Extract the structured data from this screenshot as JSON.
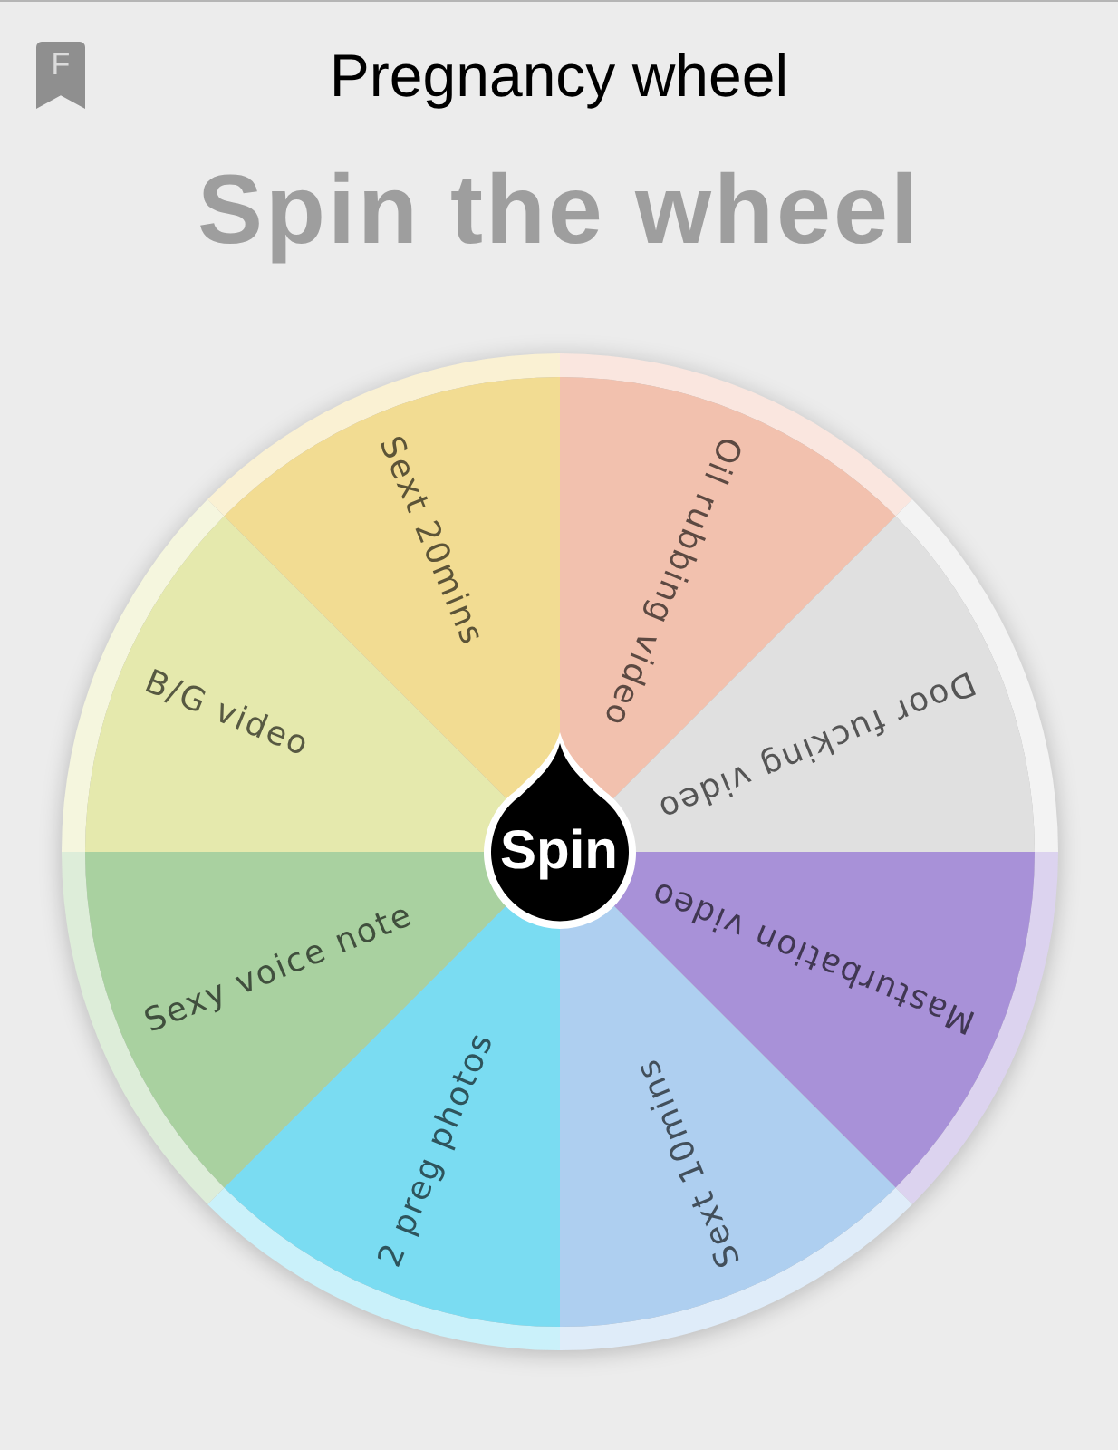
{
  "header": {
    "bookmark_letter": "F",
    "title": "Pregnancy wheel"
  },
  "heading": "Spin the wheel",
  "wheel": {
    "segments": [
      {
        "label": "Oil rubbing video",
        "color": "#f2c1ae"
      },
      {
        "label": "Door fucking video",
        "color": "#e0e0e0"
      },
      {
        "label": "Masturbation video",
        "color": "#a891d8"
      },
      {
        "label": "Sext 10mins",
        "color": "#aecff0"
      },
      {
        "label": "2 preg photos",
        "color": "#7adcf2"
      },
      {
        "label": "Sexy voice note",
        "color": "#a9d1a0"
      },
      {
        "label": "B/G video",
        "color": "#e5e9ad"
      },
      {
        "label": "Sext 20mins",
        "color": "#f2dc92"
      }
    ],
    "spin_button": "Spin"
  }
}
